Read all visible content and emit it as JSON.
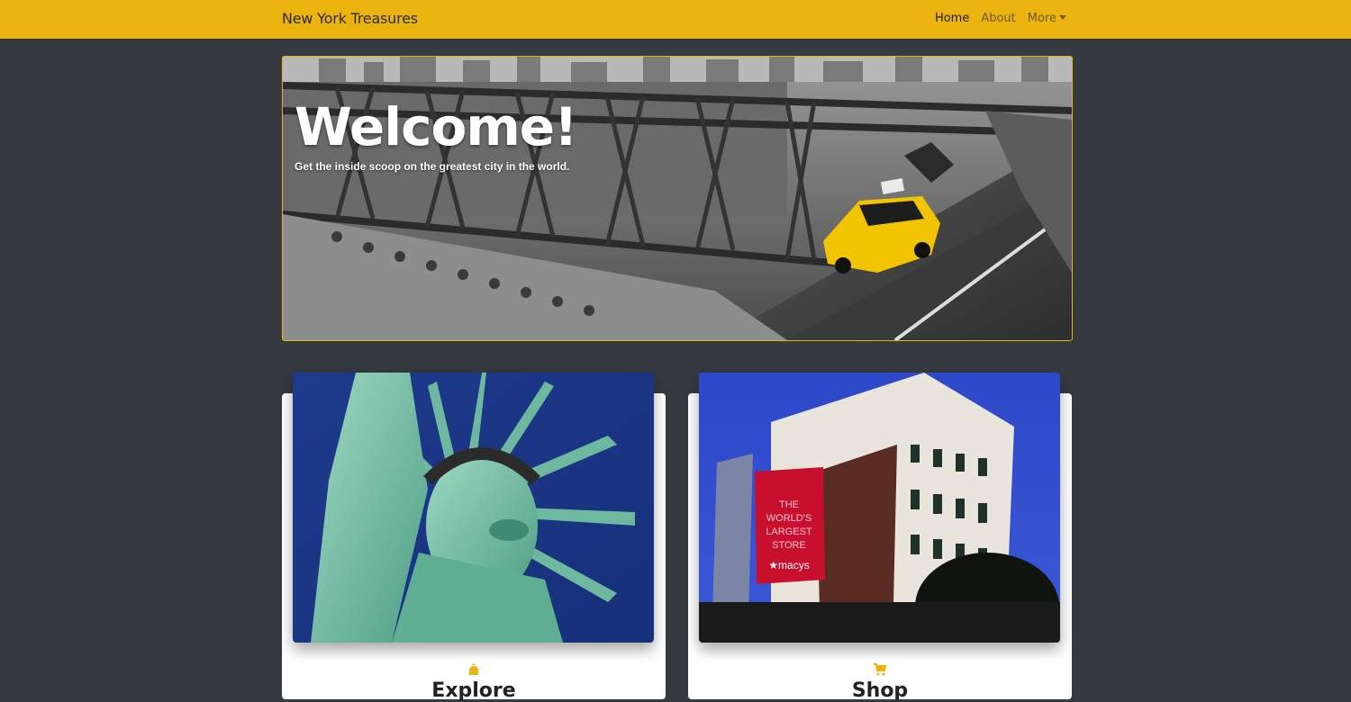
{
  "navbar": {
    "brand": "New York Treasures",
    "links": [
      {
        "label": "Home",
        "active": true
      },
      {
        "label": "About",
        "active": false
      },
      {
        "label": "More",
        "active": false
      }
    ],
    "color": "#ebb30d"
  },
  "hero": {
    "title": "Welcome!",
    "subtitle": "Get the inside scoop on the greatest city in the world."
  },
  "cards": [
    {
      "icon": "landmark-icon",
      "title": "Explore"
    },
    {
      "icon": "shopping-cart-icon",
      "title": "Shop"
    }
  ],
  "colors": {
    "background": "#343a40",
    "accent": "#ebb30d"
  }
}
